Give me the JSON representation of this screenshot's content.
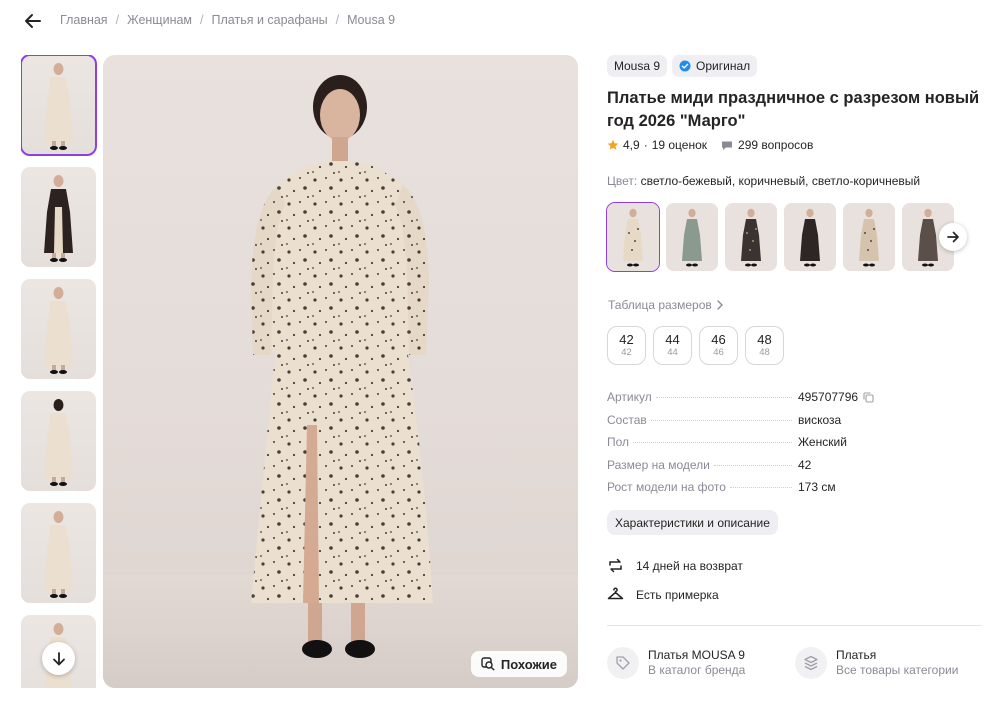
{
  "breadcrumb": [
    "Главная",
    "Женщинам",
    "Платья и сарафаны",
    "Mousa 9"
  ],
  "gallery": {
    "thumb_count": 6,
    "similar_label": "Похожие"
  },
  "product": {
    "brand": "Mousa 9",
    "original_label": "Оригинал",
    "title": "Платье миди праздничное с разрезом новый год 2026 \"Марго\"",
    "rating": "4,9",
    "rating_sep": "·",
    "reviews": "19 оценок",
    "questions": "299 вопросов",
    "color_label": "Цвет:",
    "color_value": "светло-бежевый, коричневый, светло-коричневый"
  },
  "colors": [
    {
      "name": "light-beige",
      "dress": "#e6d9c6",
      "dots": true
    },
    {
      "name": "green",
      "dress": "#8b9a8e",
      "dots": false
    },
    {
      "name": "floral",
      "dress": "#3a3431",
      "dots": true
    },
    {
      "name": "black",
      "dress": "#2e2624",
      "dots": false
    },
    {
      "name": "beige-print",
      "dress": "#d6c3ad",
      "dots": true
    },
    {
      "name": "brown",
      "dress": "#5a4f49",
      "dots": false
    }
  ],
  "sizes": {
    "table_link": "Таблица размеров",
    "items": [
      {
        "ru": "42",
        "intl": "42"
      },
      {
        "ru": "44",
        "intl": "44"
      },
      {
        "ru": "46",
        "intl": "46"
      },
      {
        "ru": "48",
        "intl": "48"
      }
    ]
  },
  "properties": [
    {
      "key": "Артикул",
      "value": "495707796"
    },
    {
      "key": "Состав",
      "value": "вискоза"
    },
    {
      "key": "Пол",
      "value": "Женский"
    },
    {
      "key": "Размер на модели",
      "value": "42"
    },
    {
      "key": "Рост модели на фото",
      "value": "173 см"
    }
  ],
  "chars_button": "Характеристики и описание",
  "features": {
    "returns": "14 дней на возврат",
    "fitting": "Есть примерка"
  },
  "categories": [
    {
      "title": "Платья MOUSA 9",
      "subtitle": "В каталог бренда"
    },
    {
      "title": "Платья",
      "subtitle": "Все товары категории"
    }
  ],
  "colors_theme": {
    "accent": "#8e3fe0",
    "star": "#f7a21b",
    "verified": "#1f8cf0"
  }
}
